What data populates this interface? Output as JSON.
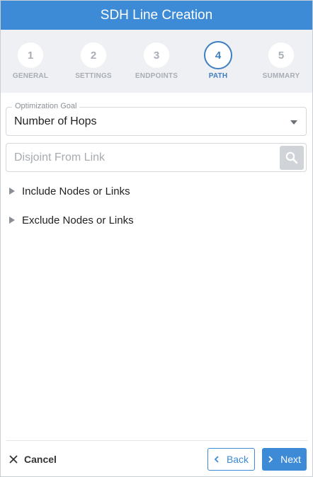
{
  "window": {
    "title": "SDH Line Creation"
  },
  "stepper": {
    "steps": [
      {
        "number": "1",
        "label": "GENERAL"
      },
      {
        "number": "2",
        "label": "SETTINGS"
      },
      {
        "number": "3",
        "label": "ENDPOINTS"
      },
      {
        "number": "4",
        "label": "PATH",
        "active": true
      },
      {
        "number": "5",
        "label": "SUMMARY"
      }
    ]
  },
  "form": {
    "optimization_goal": {
      "label": "Optimization Goal",
      "value": "Number of Hops"
    },
    "disjoint": {
      "placeholder": "Disjoint From Link",
      "value": ""
    },
    "include_label": "Include Nodes or Links",
    "exclude_label": "Exclude Nodes or Links"
  },
  "footer": {
    "cancel_label": "Cancel",
    "back_label": "Back",
    "next_label": "Next"
  },
  "colors": {
    "accent": "#3d8bd6",
    "active_step": "#3d7fc0",
    "stepper_bg": "#eef0f4",
    "inactive_step": "#a9adb5"
  },
  "icons": {
    "search": "search-icon",
    "dropdown": "chevron-down-icon",
    "expand": "triangle-right-icon",
    "cancel": "close-icon",
    "back": "chevron-left-icon",
    "next": "chevron-right-icon"
  }
}
